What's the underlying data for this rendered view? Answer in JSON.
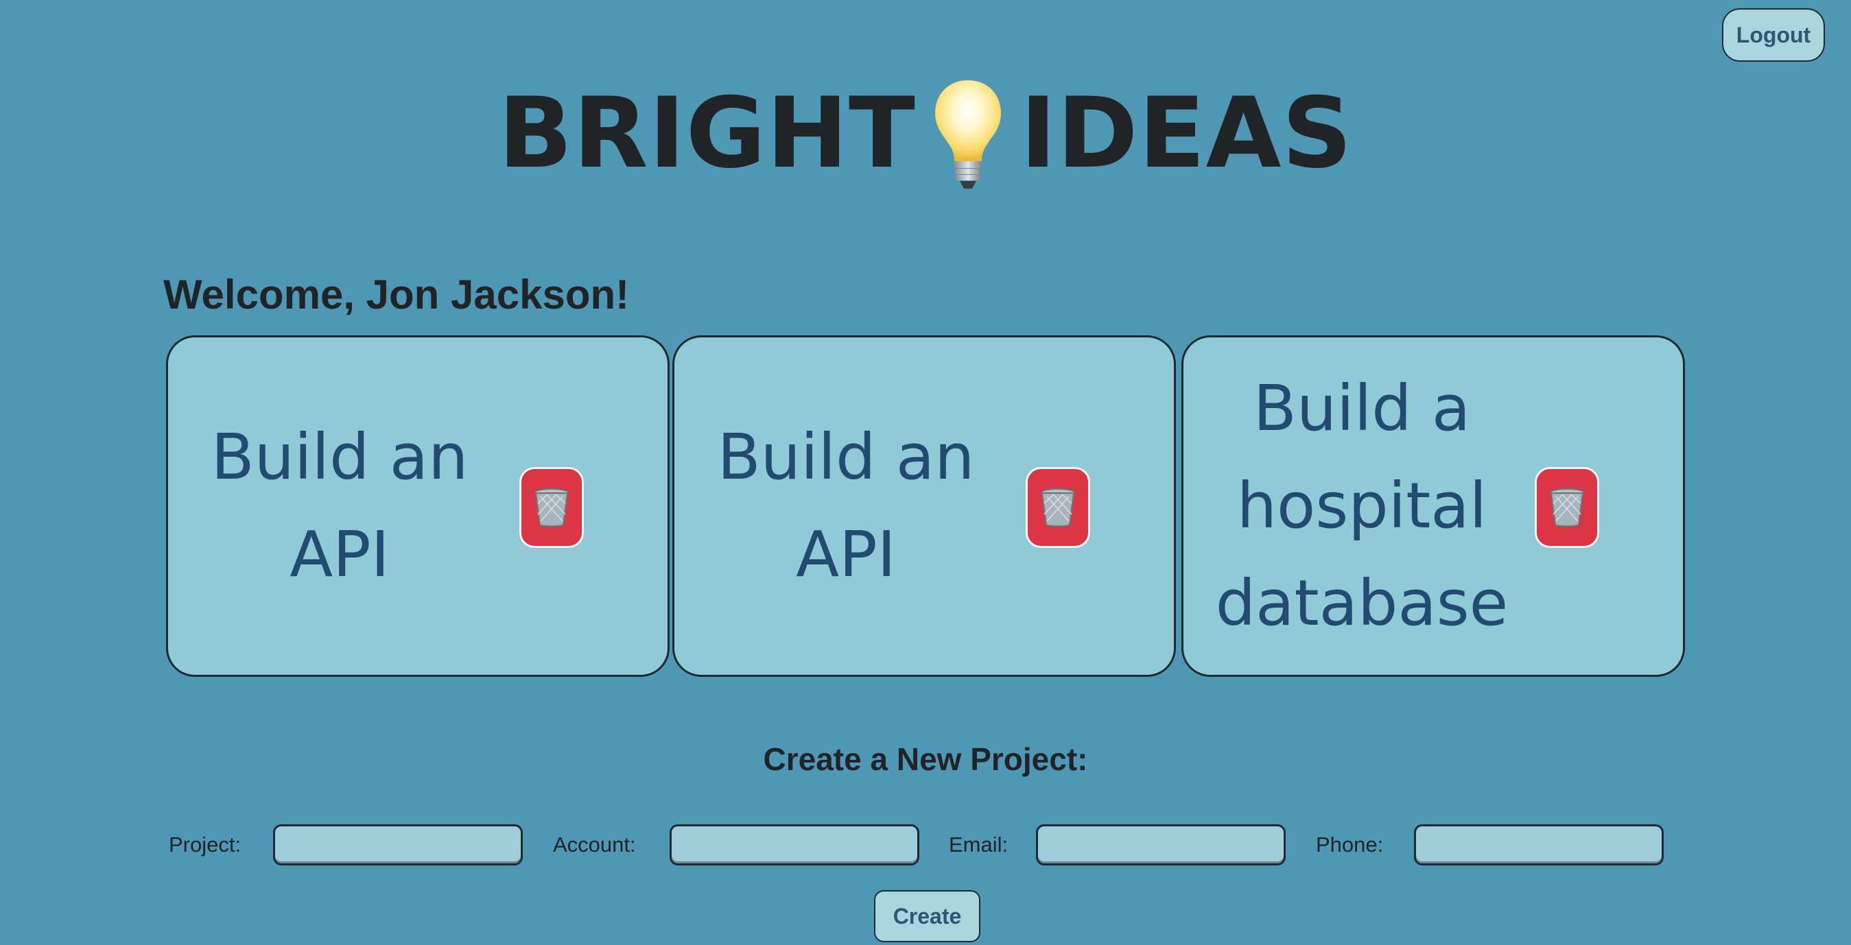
{
  "header": {
    "logout_label": "Logout"
  },
  "logo": {
    "word_left": "BRIGHT",
    "word_right": "IDEAS",
    "icon": "lightbulb-icon"
  },
  "welcome": {
    "text": "Welcome, Jon Jackson!"
  },
  "projects": [
    {
      "title": "Build an API",
      "delete_icon": "trash-icon"
    },
    {
      "title": "Build an API",
      "delete_icon": "trash-icon"
    },
    {
      "title": "Build a hospital database",
      "delete_icon": "trash-icon"
    }
  ],
  "create_form": {
    "heading": "Create a New Project:",
    "fields": [
      {
        "label": "Project:",
        "value": "",
        "placeholder": ""
      },
      {
        "label": "Account:",
        "value": "",
        "placeholder": ""
      },
      {
        "label": "Email:",
        "value": "",
        "placeholder": ""
      },
      {
        "label": "Phone:",
        "value": "",
        "placeholder": ""
      }
    ],
    "submit_label": "Create"
  },
  "colors": {
    "background": "#4e98b6",
    "card": "#8fcad6",
    "card_text": "#234a70",
    "delete_button": "#dc3545",
    "button": "#a9d6de",
    "button_text": "#2f5673"
  }
}
